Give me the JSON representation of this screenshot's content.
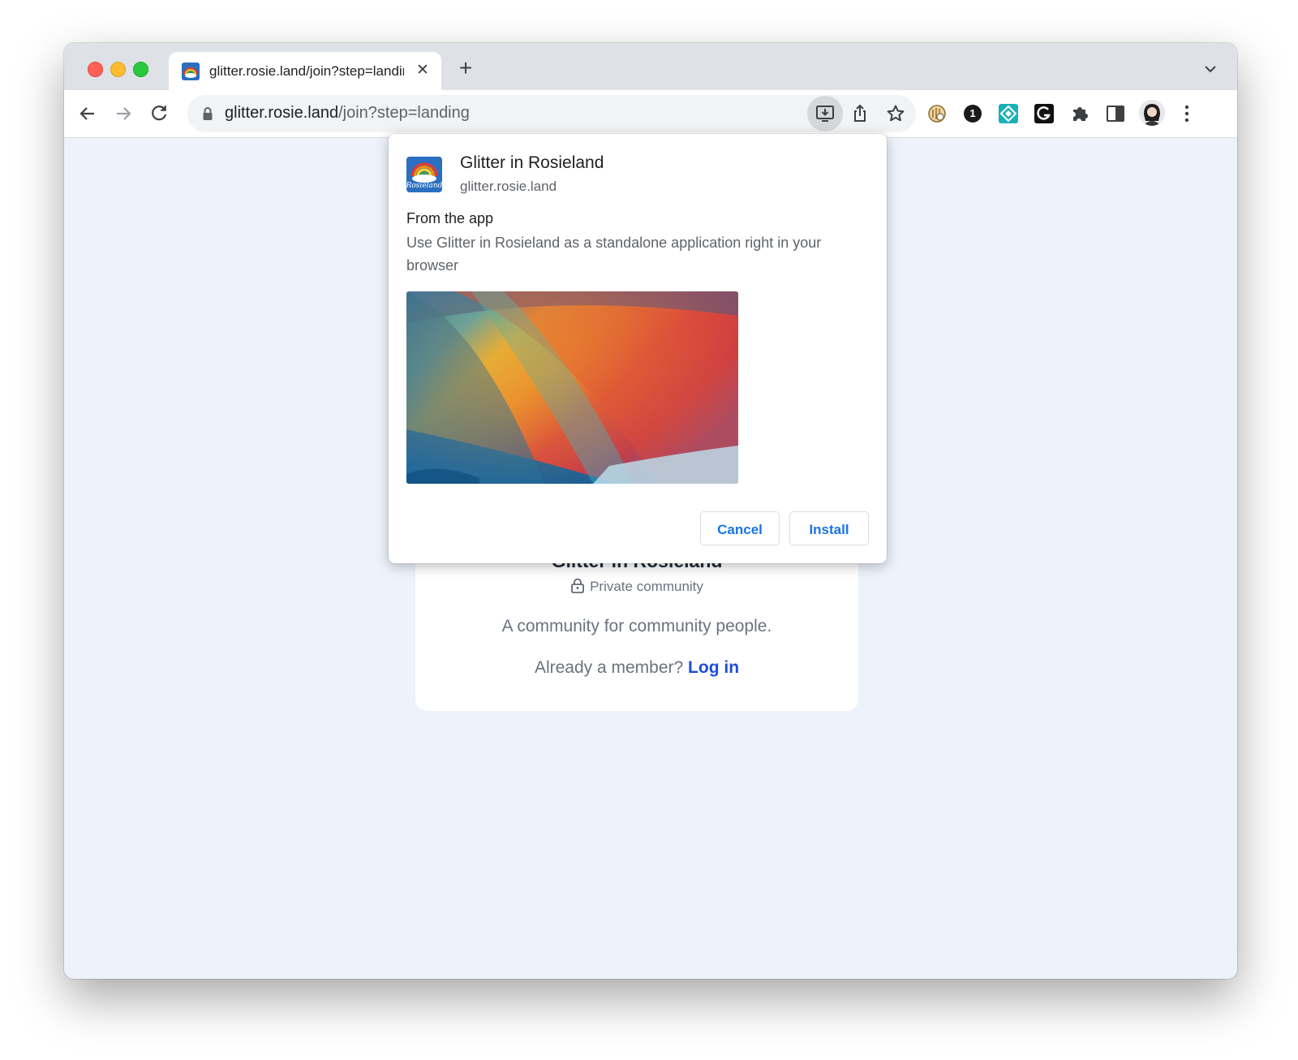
{
  "tab": {
    "title": "glitter.rosie.land/join?step=landing",
    "close_label": "✕",
    "new_tab_label": "+"
  },
  "address_bar": {
    "host": "glitter.rosie.land",
    "path": "/join?step=landing"
  },
  "install_dialog": {
    "app_name": "Glitter in Rosieland",
    "origin": "glitter.rosie.land",
    "icon_text": "Rosieland",
    "from_label": "From the app",
    "description": "Use Glitter in Rosieland as a standalone application right in your browser",
    "cancel_label": "Cancel",
    "install_label": "Install"
  },
  "community_card": {
    "title": "Glitter in Rosieland",
    "privacy": "Private community",
    "description": "A community for community people.",
    "member_prompt": "Already a member?",
    "login_label": "Log in"
  },
  "extensions": {
    "onepassword_label": "1"
  },
  "colors": {
    "accent": "#1a73e8",
    "login_link": "#1d4ed8",
    "page_bg": "#eef2fb",
    "tab_strip": "#dee1e6"
  },
  "icons": [
    "back-arrow-icon",
    "forward-arrow-icon",
    "reload-icon",
    "lock-icon",
    "install-app-icon",
    "share-icon",
    "bookmark-star-icon",
    "extension-puzzle-icon",
    "side-panel-icon",
    "kebab-menu-icon",
    "chevron-down-icon"
  ]
}
